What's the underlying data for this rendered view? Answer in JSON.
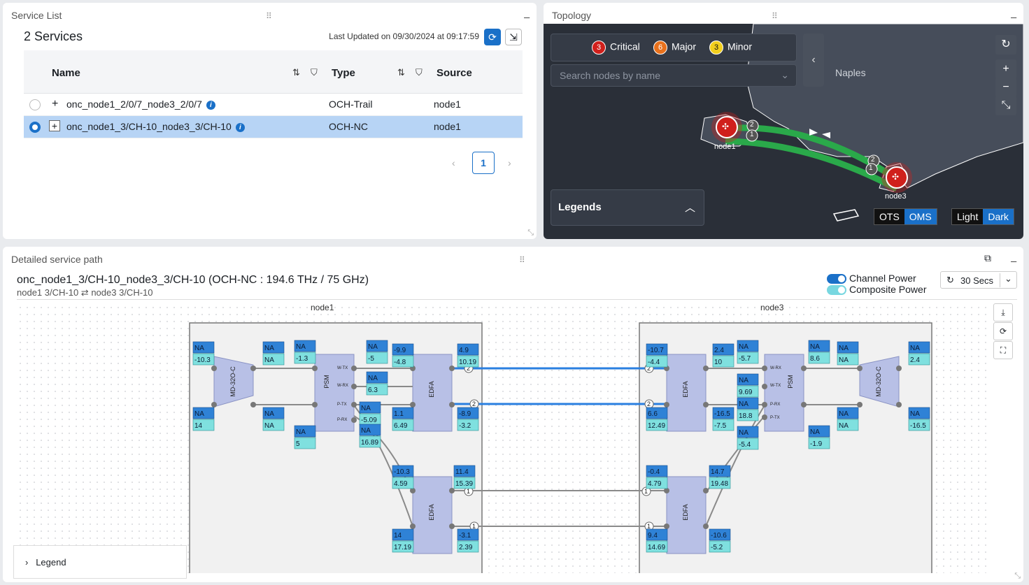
{
  "service_list": {
    "title": "Service List",
    "count_label": "2 Services",
    "last_updated": "Last Updated on 09/30/2024 at 09:17:59",
    "columns": {
      "name": "Name",
      "type": "Type",
      "source": "Source"
    },
    "rows": [
      {
        "name": "onc_node1_2/0/7_node3_2/0/7",
        "type": "OCH-Trail",
        "source": "node1",
        "selected": false
      },
      {
        "name": "onc_node1_3/CH-10_node3_3/CH-10",
        "type": "OCH-NC",
        "source": "node1",
        "selected": true
      }
    ],
    "page": "1"
  },
  "topology": {
    "title": "Topology",
    "alarms": [
      {
        "count": "3",
        "label": "Critical",
        "color": "#d0201c"
      },
      {
        "count": "6",
        "label": "Major",
        "color": "#e8711c"
      },
      {
        "count": "3",
        "label": "Minor",
        "color": "#f2cf1d"
      }
    ],
    "search_placeholder": "Search nodes by name",
    "city_label": "Naples",
    "nodes": [
      "node1",
      "node3"
    ],
    "link_labels": {
      "node1_top": "2",
      "node1_bottom": "1",
      "node3_top": "2",
      "node3_bottom": "1"
    },
    "legends_label": "Legends",
    "layer_toggle": {
      "ots": "OTS",
      "oms": "OMS"
    },
    "theme_toggle": {
      "light": "Light",
      "dark": "Dark"
    }
  },
  "detail": {
    "title": "Detailed service path",
    "service_title": "onc_node1_3/CH-10_node3_3/CH-10 (OCH-NC : 194.6 THz / 75 GHz)",
    "endpoint_a": "node1 3/CH-10",
    "endpoint_b": "node3 3/CH-10",
    "channel_power": "Channel Power",
    "composite_power": "Composite Power",
    "refresh_interval": "30 Secs",
    "node_left": "node1",
    "node_right": "node3",
    "legend_label": "Legend",
    "block_labels": {
      "mux": "MD-32O-C",
      "psm": "PSM",
      "edfa": "EDFA"
    },
    "port_labels": {
      "wtx": "W-TX",
      "wrx": "W-RX",
      "ptx": "P-TX",
      "prx": "P-RX"
    },
    "left_values": {
      "mux_in_top": [
        "NA",
        "-10.3"
      ],
      "mux_out_top": [
        "NA",
        "NA"
      ],
      "mux_in_bot": [
        "NA",
        "14"
      ],
      "mux_out_bot": [
        "NA",
        "NA"
      ],
      "psm_in_top": [
        "NA",
        "-1.3"
      ],
      "psm_in_bot": [
        "NA",
        "5"
      ],
      "psm_wtx": [
        "NA",
        "-5"
      ],
      "psm_wrx": [
        "NA",
        "6.3"
      ],
      "psm_ptx": [
        "NA",
        "-5.09"
      ],
      "psm_prx": [
        "NA",
        "16.89"
      ],
      "edfa1_in": [
        "-9.9",
        "-4.8"
      ],
      "edfa1_out": [
        "4.9",
        "10.19"
      ],
      "edfa1_bin": [
        "1.1",
        "6.49"
      ],
      "edfa1_bout": [
        "-8.9",
        "-3.2"
      ],
      "edfa2_in": [
        "-10.3",
        "4.59"
      ],
      "edfa2_out": [
        "11.4",
        "15.39"
      ],
      "edfa2_bin": [
        "14",
        "17.19"
      ],
      "edfa2_bout": [
        "-3.1",
        "2.39"
      ]
    },
    "right_values": {
      "edfa1_in": [
        "-10.7",
        "-4.4"
      ],
      "edfa1_out": [
        "2.4",
        "10"
      ],
      "edfa1_bin": [
        "6.6",
        "12.49"
      ],
      "edfa1_bout": [
        "-16.5",
        "-7.5"
      ],
      "psm_wrx": [
        "NA",
        "-5.7"
      ],
      "psm_wtx": [
        "NA",
        "9.69"
      ],
      "psm_prx": [
        "NA",
        "18.8"
      ],
      "psm_ptx": [
        "NA",
        "-5.4"
      ],
      "psm_out_top": [
        "NA",
        "8.6"
      ],
      "psm_out_bot": [
        "NA",
        "-1.9"
      ],
      "mux_in_top": [
        "NA",
        "NA"
      ],
      "mux_out_top": [
        "NA",
        "2.4"
      ],
      "mux_in_bot": [
        "NA",
        "NA"
      ],
      "mux_out_bot": [
        "NA",
        "-16.5"
      ],
      "edfa2_in": [
        "-0.4",
        "4.79"
      ],
      "edfa2_out": [
        "14.7",
        "19.48"
      ],
      "edfa2_bin": [
        "9.4",
        "14.69"
      ],
      "edfa2_bout": [
        "-10.6",
        "-5.2"
      ]
    },
    "link_markers": {
      "a": "2",
      "b": "2",
      "c": "1",
      "d": "1"
    }
  }
}
